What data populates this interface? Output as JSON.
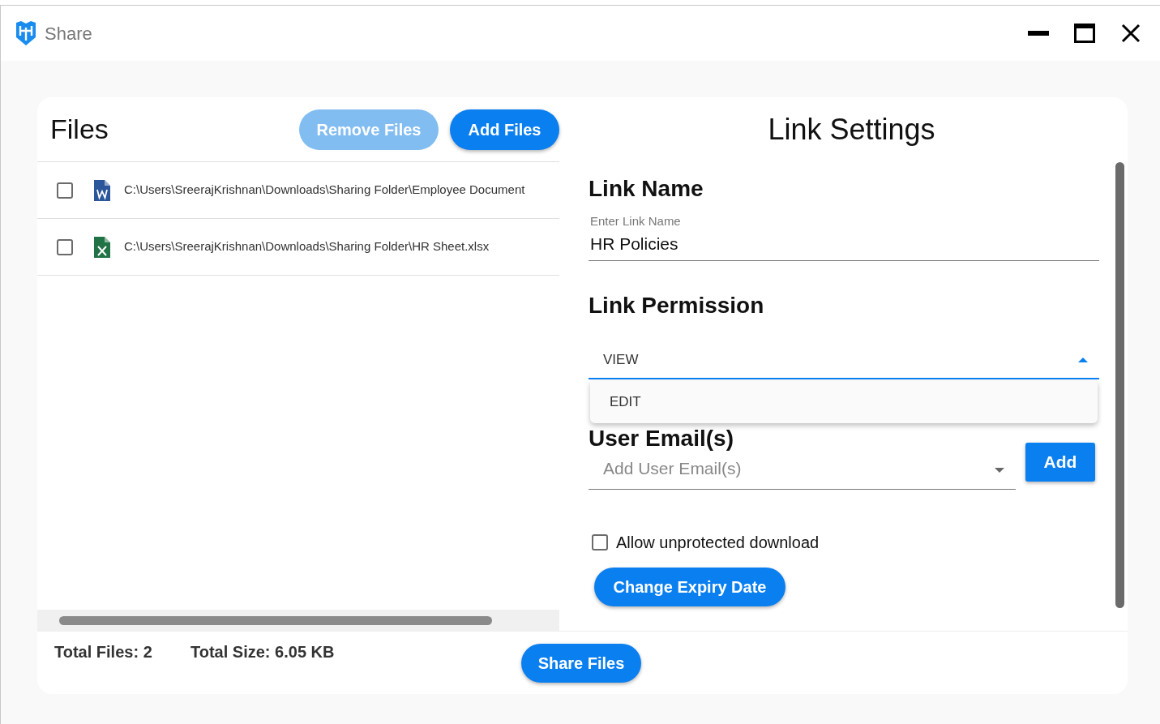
{
  "window": {
    "title": "Share"
  },
  "files_panel": {
    "title": "Files",
    "remove_button": {
      "label": "Remove Files",
      "disabled": true
    },
    "add_button": {
      "label": "Add Files",
      "disabled": false
    },
    "rows": [
      {
        "kind": "word",
        "path": "C:\\Users\\SreerajKrishnan\\Downloads\\Sharing Folder\\Employee Document",
        "checked": false
      },
      {
        "kind": "excel",
        "path": "C:\\Users\\SreerajKrishnan\\Downloads\\Sharing Folder\\HR Sheet.xlsx",
        "checked": false
      }
    ]
  },
  "link_settings": {
    "title": "Link Settings",
    "link_name": {
      "heading": "Link Name",
      "label": "Enter Link Name",
      "value": "HR Policies"
    },
    "permission": {
      "heading": "Link Permission",
      "value": "VIEW",
      "expanded": true,
      "options": [
        {
          "label": "EDIT",
          "selected": false
        }
      ]
    },
    "user_emails": {
      "heading": "User Email(s)",
      "placeholder": "Add User Email(s)",
      "add_button": "Add"
    },
    "allow_download": {
      "label": "Allow unprotected download",
      "checked": false
    },
    "expiry_button": "Change Expiry Date"
  },
  "footer": {
    "total_files": "Total Files: 2",
    "total_size": "Total Size: 6.05 KB",
    "share_button": "Share Files"
  }
}
